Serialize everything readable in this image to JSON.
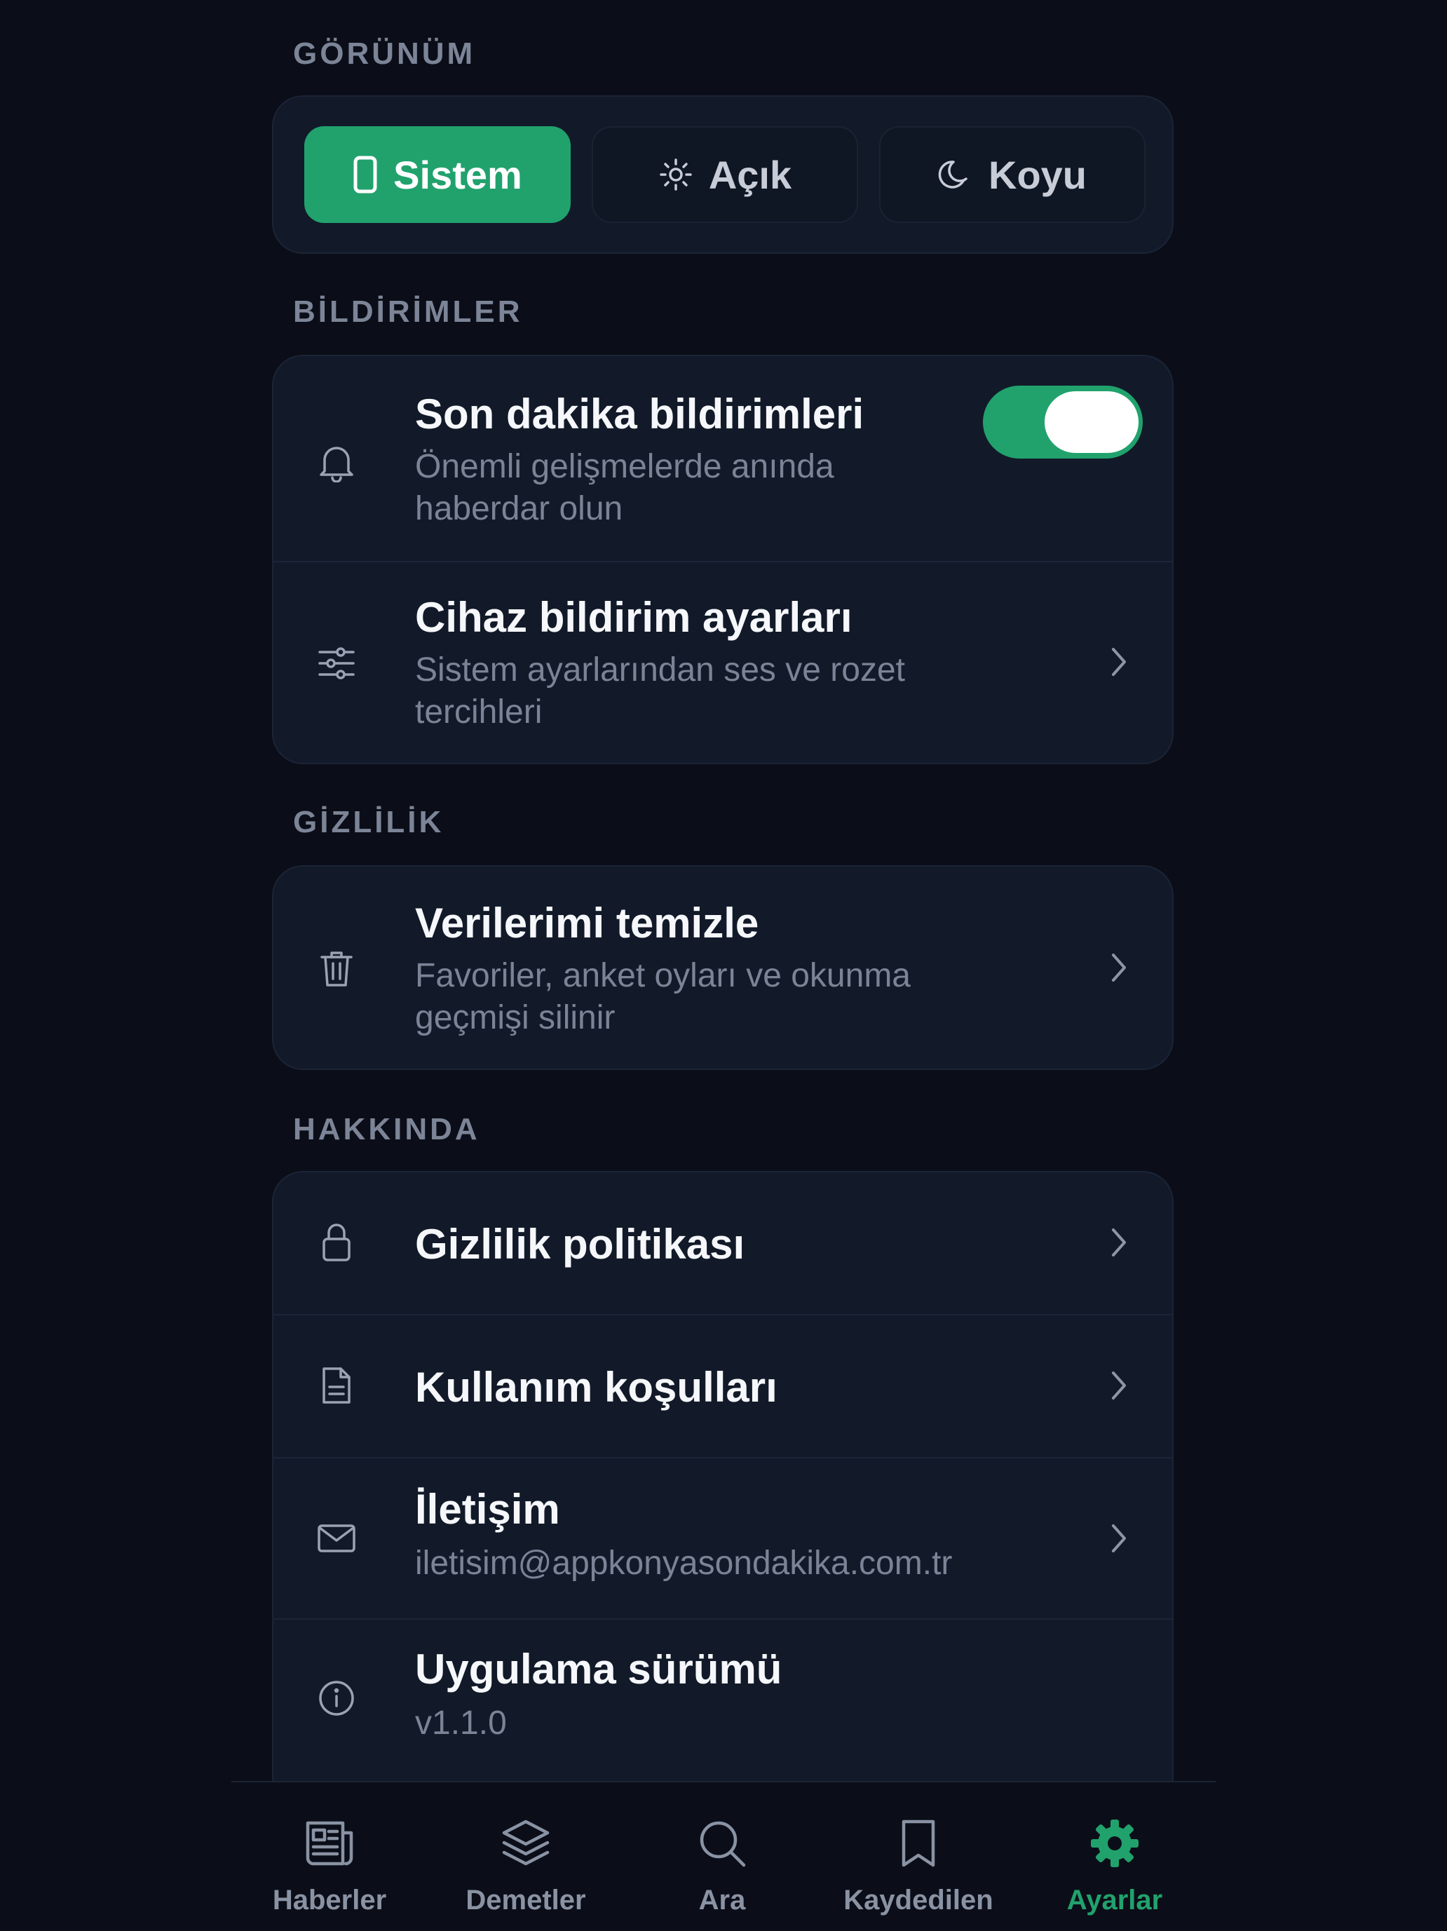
{
  "appearance": {
    "label": "GÖRÜNÜM",
    "options": [
      {
        "label": "Sistem",
        "icon": "phone-icon",
        "selected": true
      },
      {
        "label": "Açık",
        "icon": "sun-icon",
        "selected": false
      },
      {
        "label": "Koyu",
        "icon": "moon-icon",
        "selected": false
      }
    ]
  },
  "notifications": {
    "label": "BİLDİRİMLER",
    "breaking": {
      "title": "Son dakika bildirimleri",
      "subtitle": "Önemli gelişmelerde anında haberdar olun",
      "icon": "bell-icon",
      "enabled": true
    },
    "device": {
      "title": "Cihaz bildirim ayarları",
      "subtitle": "Sistem ayarlarından ses ve rozet tercihleri",
      "icon": "sliders-icon"
    }
  },
  "privacy": {
    "label": "GİZLİLİK",
    "clear": {
      "title": "Verilerimi temizle",
      "subtitle": "Favoriler, anket oyları ve okunma geçmişi silinir",
      "icon": "trash-icon"
    }
  },
  "about": {
    "label": "HAKKINDA",
    "policy": {
      "title": "Gizlilik politikası",
      "icon": "lock-icon"
    },
    "terms": {
      "title": "Kullanım koşulları",
      "icon": "document-icon"
    },
    "contact": {
      "title": "İletişim",
      "subtitle": "iletisim@appkonyasondakika.com.tr",
      "icon": "mail-icon"
    },
    "version": {
      "title": "Uygulama sürümü",
      "subtitle": "v1.1.0",
      "icon": "info-icon"
    }
  },
  "tabbar": {
    "tabs": [
      {
        "label": "Haberler",
        "icon": "newspaper-icon",
        "active": false
      },
      {
        "label": "Demetler",
        "icon": "layers-icon",
        "active": false
      },
      {
        "label": "Ara",
        "icon": "search-icon",
        "active": false
      },
      {
        "label": "Kaydedilen",
        "icon": "bookmark-icon",
        "active": false
      },
      {
        "label": "Ayarlar",
        "icon": "gear-icon",
        "active": true
      }
    ]
  },
  "colors": {
    "background": "#0b0e18",
    "card": "#121a29",
    "accent": "#21a26d",
    "muted": "#7b8496"
  }
}
